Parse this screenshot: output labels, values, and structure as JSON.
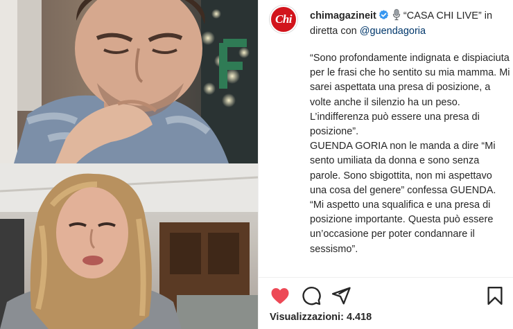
{
  "post": {
    "username": "chimagazineit",
    "avatar_text": "Chi",
    "verified": true,
    "title_quote": "“CASA CHI LIVE”",
    "title_rest": " in diretta con ",
    "mention": "@guendagoria",
    "caption_lines": [
      "“Sono profondamente indignata e dispiaciuta per le frasi che ho sentito su mia mamma. Mi sarei aspettata una presa di posizione, a volte anche il silenzio ha un peso. L’indifferenza può essere una presa di posizione”.",
      "GUENDA GORIA non le manda a dire “Mi sento umiliata da donna e sono senza parole. Sono sbigottita, non mi aspettavo una cosa del genere” confessa GUENDA.",
      "“Mi aspetto una squalifica e una presa di posizione importante. Questa può essere un’occasione per poter condannare il sessismo”."
    ],
    "views_label": "Visualizzazioni:",
    "views_count": "4.418"
  },
  "icons": {
    "like": "heart-icon",
    "comment": "comment-icon",
    "share": "share-icon",
    "save": "bookmark-icon",
    "verified": "verified-badge-icon",
    "mic": "microphone-icon"
  },
  "colors": {
    "like_red": "#ed4956",
    "verified_blue": "#3897f0",
    "brand_red": "#d2141c",
    "mention_blue": "#00376b"
  }
}
